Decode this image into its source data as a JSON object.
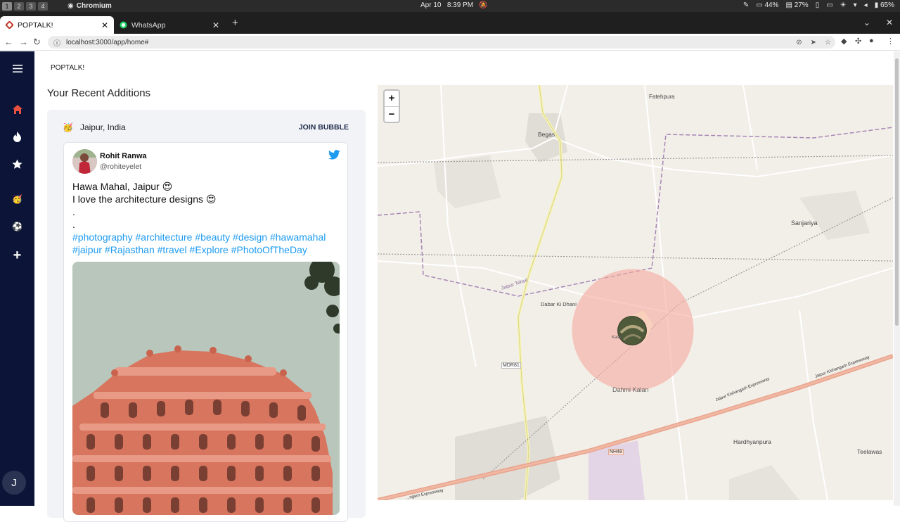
{
  "system": {
    "workspaces": [
      "1",
      "2",
      "3",
      "4"
    ],
    "app_name": "Chromium",
    "date": "Apr 10",
    "time": "8:39 PM",
    "cpu": "44%",
    "mem": "27%",
    "battery": "65%"
  },
  "browser": {
    "tabs": [
      {
        "label": "POPTALK!",
        "active": true
      },
      {
        "label": "WhatsApp",
        "active": false
      }
    ],
    "url": "localhost:3000/app/home#"
  },
  "sidebar": {
    "items": [
      {
        "icon": "menu-icon",
        "symbol": "≡"
      },
      {
        "icon": "home-icon",
        "symbol": "⌂"
      },
      {
        "icon": "fire-icon",
        "symbol": "🔥"
      },
      {
        "icon": "star-icon",
        "symbol": "★"
      },
      {
        "icon": "party-face-icon",
        "symbol": "🥳"
      },
      {
        "icon": "soccer-ball-icon",
        "symbol": "⚽"
      },
      {
        "icon": "add-icon",
        "symbol": "+"
      }
    ],
    "avatar_initial": "J",
    "accent": "#0c1537"
  },
  "main": {
    "brand": "POPTALK!",
    "heading": "Your Recent Additions",
    "bubble": {
      "emoji": "🥳",
      "location": "Jaipur, India",
      "join_label": "JOIN BUBBLE"
    },
    "tweet": {
      "name": "Rohit Ranwa",
      "handle": "@rohiteyelet",
      "line1": "Hawa Mahal, Jaipur 😍",
      "line2": "I love the architecture designs 😍",
      "dot1": ".",
      "dot2": ".",
      "hashtags": "#photography #architecture #beauty #design #hawamahal #jaipur #Rajasthan #travel #Explore #PhotoOfTheDay"
    }
  },
  "map": {
    "zoom_in": "+",
    "zoom_out": "−",
    "labels": {
      "fatehpura": "Fatehpura",
      "begas": "Begas",
      "sanjariya": "Sanjariya",
      "jaipur_tehsil": "Jaipur Tehsil",
      "dabar": "Dabar Ki Dhani",
      "mdr81": "MDR81",
      "dahmi": "Dahmi Kalan",
      "nh48": "NH48",
      "hardhyanpura": "Hardhyanpura",
      "teelawas": "Teelawas",
      "expressway": "Jaipur Kishangarh Expressway",
      "expressway2": "Jaipur Kishangarh Expressway",
      "expressway3": "...ngarh Expressway",
      "kalan_short": "Kalan"
    }
  }
}
